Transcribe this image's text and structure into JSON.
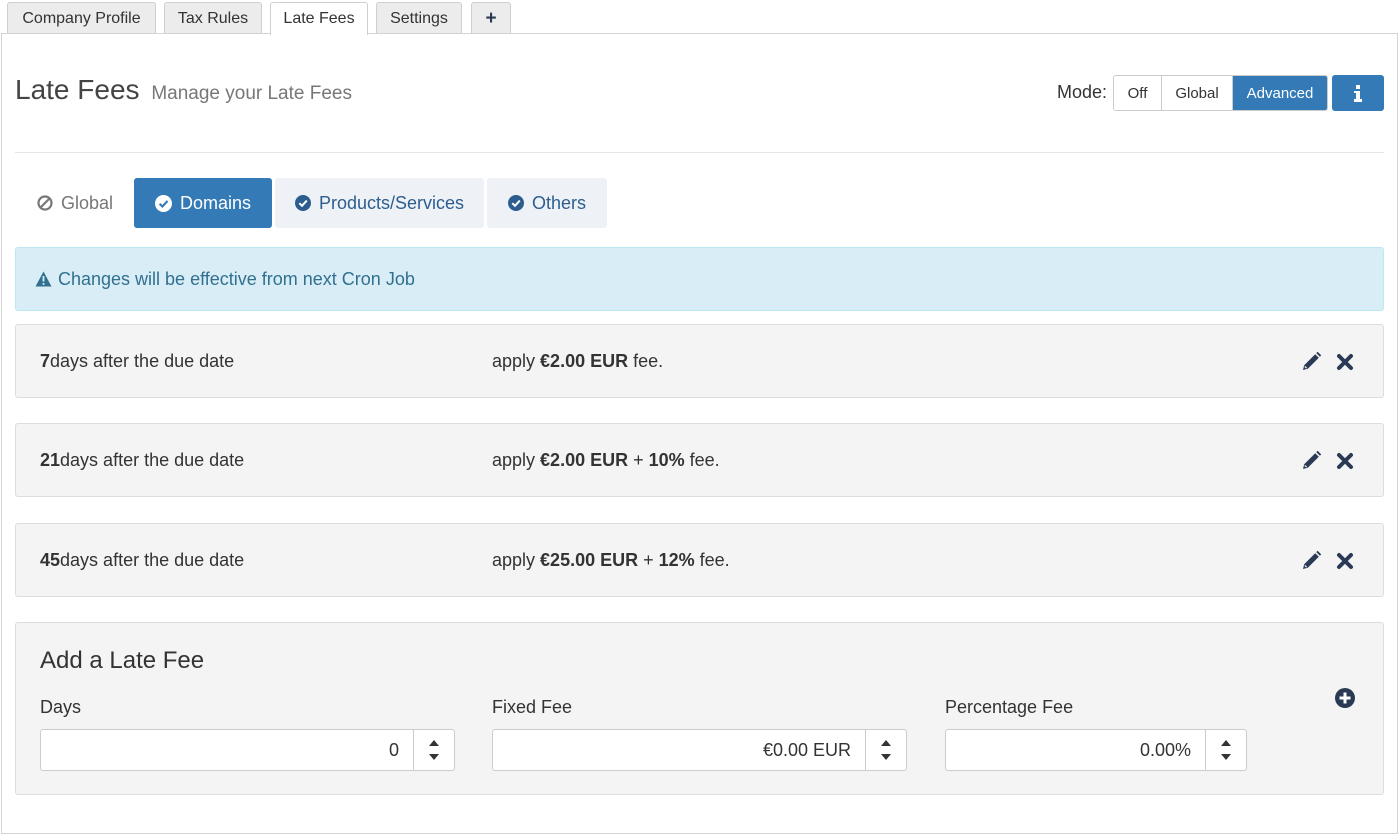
{
  "top_tabs": [
    {
      "label": "Company Profile",
      "active": false
    },
    {
      "label": "Tax Rules",
      "active": false
    },
    {
      "label": "Late Fees",
      "active": true
    },
    {
      "label": "Settings",
      "active": false
    },
    {
      "label": "+",
      "active": false
    }
  ],
  "header": {
    "title": "Late Fees",
    "subtitle": "Manage your Late Fees",
    "mode_label": "Mode:",
    "modes": [
      "Off",
      "Global",
      "Advanced"
    ],
    "active_mode": "Advanced",
    "info_icon": "info-icon"
  },
  "section_tabs": [
    {
      "label": "Global",
      "icon": "ban-icon",
      "state": "disabled"
    },
    {
      "label": "Domains",
      "icon": "check-circle-icon",
      "state": "active"
    },
    {
      "label": "Products/Services",
      "icon": "check-circle-icon",
      "state": "enabled"
    },
    {
      "label": "Others",
      "icon": "check-circle-icon",
      "state": "enabled"
    }
  ],
  "alert": {
    "icon": "warning-icon",
    "text": "Changes will be effective from next Cron Job"
  },
  "fees": [
    {
      "days": "7",
      "days_suffix": " days after the due date",
      "prefix": "apply ",
      "fixed": "€2.00 EUR",
      "join": "",
      "percent": "",
      "suffix": " fee."
    },
    {
      "days": "21",
      "days_suffix": " days after the due date",
      "prefix": "apply ",
      "fixed": "€2.00 EUR",
      "join": " + ",
      "percent": "10%",
      "suffix": " fee."
    },
    {
      "days": "45",
      "days_suffix": " days after the due date",
      "prefix": "apply ",
      "fixed": "€25.00 EUR",
      "join": " + ",
      "percent": "12%",
      "suffix": " fee."
    }
  ],
  "add_form": {
    "title": "Add a Late Fee",
    "days_label": "Days",
    "days_value": "0",
    "fixed_label": "Fixed Fee",
    "fixed_value": "€0.00 EUR",
    "percent_label": "Percentage Fee",
    "percent_value": "0.00%"
  },
  "colors": {
    "primary": "#337ab7",
    "alert_bg": "#d9edf7",
    "alert_text": "#31708f",
    "icon_dark": "#2a3a55"
  }
}
